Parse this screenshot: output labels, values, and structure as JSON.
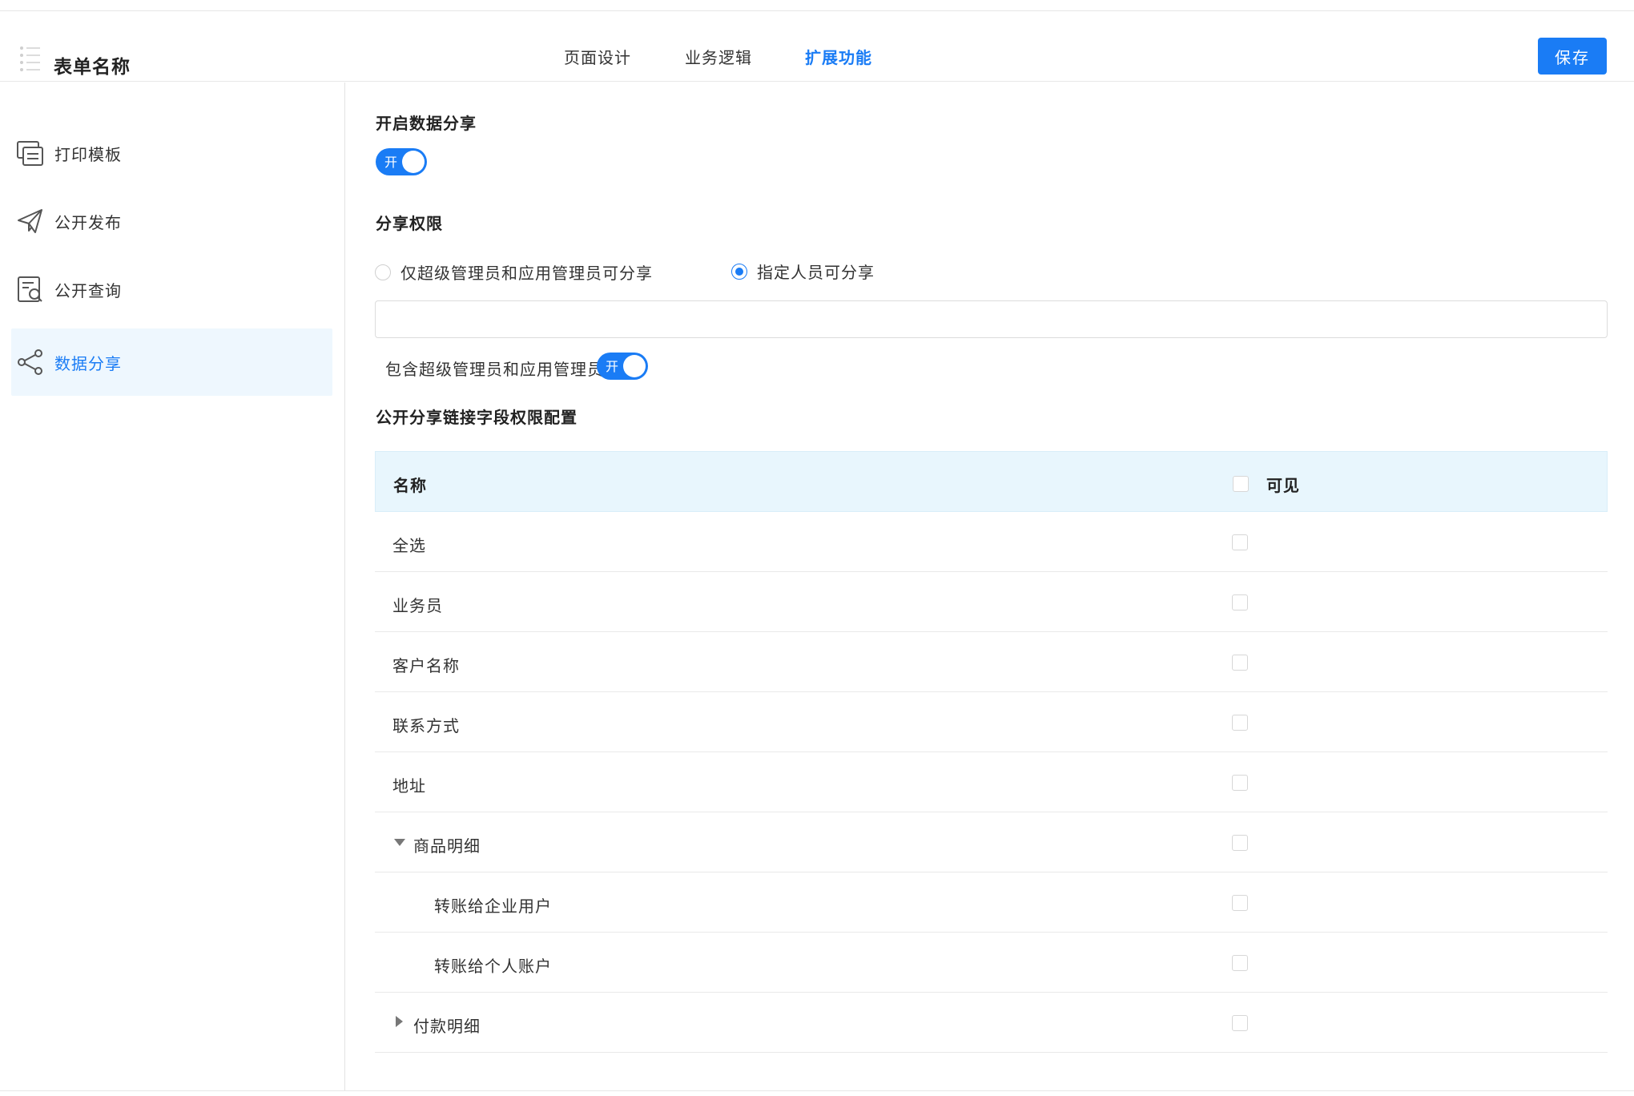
{
  "header": {
    "title": "表单名称",
    "tabs": [
      {
        "label": "页面设计"
      },
      {
        "label": "业务逻辑"
      },
      {
        "label": "扩展功能"
      }
    ],
    "save_label": "保存"
  },
  "sidebar": {
    "items": [
      {
        "label": "打印模板",
        "icon": "print-template-icon"
      },
      {
        "label": "公开发布",
        "icon": "send-icon"
      },
      {
        "label": "公开查询",
        "icon": "query-icon"
      },
      {
        "label": "数据分享",
        "icon": "share-icon"
      }
    ]
  },
  "main": {
    "enable_title": "开启数据分享",
    "toggle_on_text": "开",
    "permission_title": "分享权限",
    "radio_admin_only": "仅超级管理员和应用管理员可分享",
    "radio_specified": "指定人员可分享",
    "include_admin_label": "包含超级管理员和应用管理员",
    "field_config_title": "公开分享链接字段权限配置",
    "table": {
      "col_name": "名称",
      "col_visible": "可见",
      "rows": [
        {
          "name": "全选"
        },
        {
          "name": "业务员"
        },
        {
          "name": "客户名称"
        },
        {
          "name": "联系方式"
        },
        {
          "name": "地址"
        },
        {
          "name": "商品明细"
        },
        {
          "name": "转账给企业用户"
        },
        {
          "name": "转账给个人账户"
        },
        {
          "name": "付款明细"
        }
      ]
    }
  },
  "colors": {
    "accent": "#1a7cf5",
    "active_bg": "#eef7fe",
    "table_header_bg": "#e8f6fd"
  }
}
